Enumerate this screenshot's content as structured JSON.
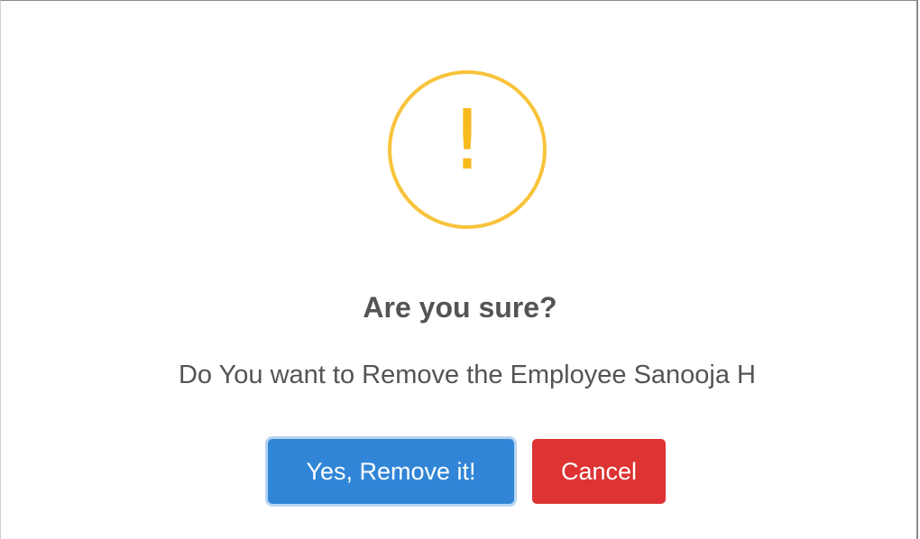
{
  "dialog": {
    "icon": {
      "name": "warning-icon",
      "glyph": "!",
      "color": "#f8bb1e"
    },
    "title": "Are you sure?",
    "message": "Do You want to Remove the Employee Sanooja H",
    "confirm_label": "Yes, Remove it!",
    "cancel_label": "Cancel",
    "colors": {
      "confirm": "#3085d6",
      "cancel": "#dd3333",
      "text": "#545454"
    }
  }
}
